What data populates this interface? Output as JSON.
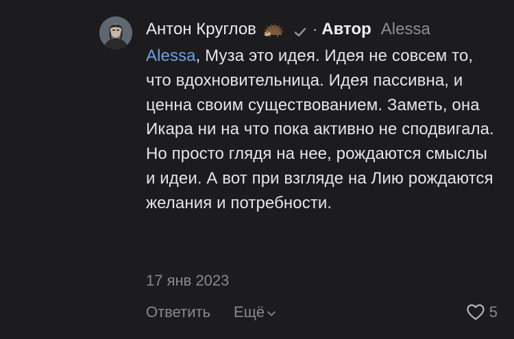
{
  "comment": {
    "author": "Антон Круглов",
    "author_badge_icon": "hedgehog-icon",
    "separator": "·",
    "role_badge": "Автор",
    "reply_to": "Alessa",
    "mention": "Alessa",
    "text": ", Муза это идея. Идея не совсем то, что вдохновительница. Идея пассивна, и ценна своим существованием. Заметь, она Икара ни на что пока активно не сподвигала. Но просто глядя на нее, рождаются смыслы и идеи. А вот при взгляде на Лию рождаются желания и потребности.",
    "date": "17 янв 2023",
    "actions": {
      "reply": "Ответить",
      "more": "Ещё"
    },
    "likes": "5"
  },
  "colors": {
    "background": "#1c1c1e",
    "text": "#e6e6e8",
    "muted": "#8a8a8e",
    "mention": "#6fa0e6"
  }
}
